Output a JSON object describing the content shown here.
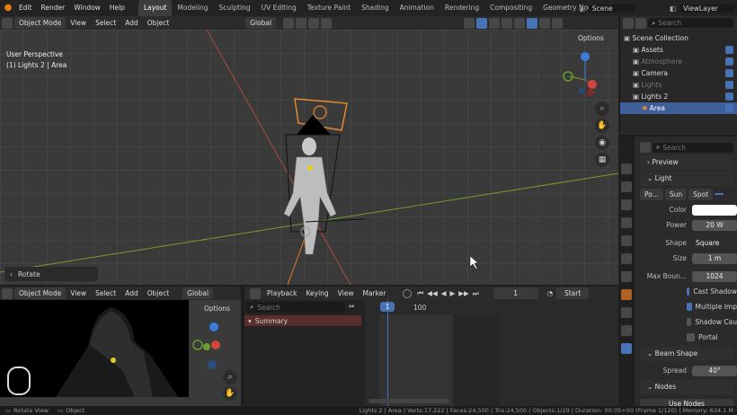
{
  "topbar": {
    "menus": [
      "Edit",
      "Render",
      "Window",
      "Help"
    ],
    "workspaces": [
      "Layout",
      "Modeling",
      "Sculpting",
      "UV Editing",
      "Texture Paint",
      "Shading",
      "Animation",
      "Rendering",
      "Compositing",
      "Geometry Node"
    ],
    "active_workspace": "Layout",
    "scene": "Scene",
    "view_layer": "ViewLayer"
  },
  "viewport": {
    "mode": "Object Mode",
    "menus": [
      "View",
      "Select",
      "Add",
      "Object"
    ],
    "transform": "Global",
    "options": "Options",
    "overlay_title": "User Perspective",
    "overlay_sub": "(1) Lights 2 | Area",
    "operator_panel": "Rotate"
  },
  "camera_view": {
    "mode": "Object Mode",
    "menus": [
      "View",
      "Select",
      "Add",
      "Object"
    ],
    "transform": "Global",
    "options": "Options"
  },
  "timeline": {
    "menus": [
      "Playback",
      "Keying",
      "View",
      "Marker"
    ],
    "current_frame": "1",
    "start_label": "Start",
    "search_placeholder": "Search",
    "summary": "Summary",
    "frame_marker": "1",
    "frame_100": "100"
  },
  "outliner": {
    "search_placeholder": "Search",
    "items": [
      {
        "label": "Scene Collection",
        "level": 0,
        "dim": false,
        "selected": false
      },
      {
        "label": "Assets",
        "level": 1,
        "dim": false,
        "selected": false
      },
      {
        "label": "Atmosphere",
        "level": 1,
        "dim": true,
        "selected": false
      },
      {
        "label": "Camera",
        "level": 1,
        "dim": false,
        "selected": false
      },
      {
        "label": "Lights",
        "level": 1,
        "dim": true,
        "selected": false
      },
      {
        "label": "Lights 2",
        "level": 1,
        "dim": false,
        "selected": false
      },
      {
        "label": "Area",
        "level": 2,
        "dim": false,
        "selected": true
      }
    ]
  },
  "properties": {
    "search_placeholder": "Search",
    "preview": "Preview",
    "light": "Light",
    "light_types": [
      "Po...",
      "Sun",
      "Spot"
    ],
    "color_label": "Color",
    "power_label": "Power",
    "power_value": "20 W",
    "shape_label": "Shape",
    "shape_value": "Square",
    "size_label": "Size",
    "size_value": "1 m",
    "max_bounces_label": "Max Boun...",
    "max_bounces_value": "1024",
    "cast_shadow": "Cast Shadow",
    "multiple_importance": "Multiple Imp",
    "shadow_caustics": "Shadow Cau",
    "portal": "Portal",
    "beam_shape": "Beam Shape",
    "spread_label": "Spread",
    "spread_value": "40°",
    "nodes": "Nodes",
    "use_nodes": "Use Nodes"
  },
  "statusbar": {
    "left1": "Rotate View",
    "left2": "Object",
    "stats": "Lights 2 | Area | Verts:17,222 | Faces:24,500 | Tris:24,500 | Objects:1/29 | Duration: 00:05+00 (Frame 1/120) | Memory: 634.1 M"
  },
  "colors": {
    "accent": "#4772b3",
    "selected_row": "#3f5f99",
    "orange_select": "#e6892e"
  }
}
